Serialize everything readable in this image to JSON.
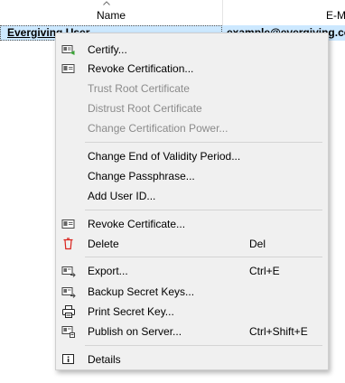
{
  "table": {
    "columns": [
      {
        "label": "Name"
      },
      {
        "label": "E-M"
      }
    ],
    "selected_row": {
      "name": "Evergiving User",
      "email": "example@evergiving.co"
    }
  },
  "menu": {
    "items": [
      {
        "id": "certify",
        "label": "Certify...",
        "enabled": true,
        "icon": "certify-icon"
      },
      {
        "id": "revoke-certification",
        "label": "Revoke Certification...",
        "enabled": true,
        "icon": "revoke-certification-icon"
      },
      {
        "id": "trust-root",
        "label": "Trust Root Certificate",
        "enabled": false
      },
      {
        "id": "distrust-root",
        "label": "Distrust Root Certificate",
        "enabled": false
      },
      {
        "id": "change-cert-power",
        "label": "Change Certification Power...",
        "enabled": false
      },
      {
        "id": "change-validity",
        "label": "Change End of Validity Period...",
        "enabled": true
      },
      {
        "id": "change-passphrase",
        "label": "Change Passphrase...",
        "enabled": true
      },
      {
        "id": "add-user-id",
        "label": "Add User ID...",
        "enabled": true
      },
      {
        "id": "revoke-certificate",
        "label": "Revoke Certificate...",
        "enabled": true,
        "icon": "revoke-certificate-icon"
      },
      {
        "id": "delete",
        "label": "Delete",
        "shortcut": "Del",
        "enabled": true,
        "icon": "trash-icon",
        "icon_color": "#d9221c"
      },
      {
        "id": "export",
        "label": "Export...",
        "shortcut": "Ctrl+E",
        "enabled": true,
        "icon": "export-icon"
      },
      {
        "id": "backup-secret-keys",
        "label": "Backup Secret Keys...",
        "enabled": true,
        "icon": "backup-icon"
      },
      {
        "id": "print-secret-key",
        "label": "Print Secret Key...",
        "enabled": true,
        "icon": "printer-icon"
      },
      {
        "id": "publish-on-server",
        "label": "Publish on Server...",
        "shortcut": "Ctrl+Shift+E",
        "enabled": true,
        "icon": "publish-icon"
      },
      {
        "id": "details",
        "label": "Details",
        "enabled": true,
        "icon": "info-icon"
      }
    ]
  },
  "colors": {
    "selection": "#cce8ff",
    "menu_background": "#f0f0f0",
    "disabled_text": "#8b8b8b",
    "delete_icon": "#d9221c",
    "certify_accent": "#3aa336"
  }
}
